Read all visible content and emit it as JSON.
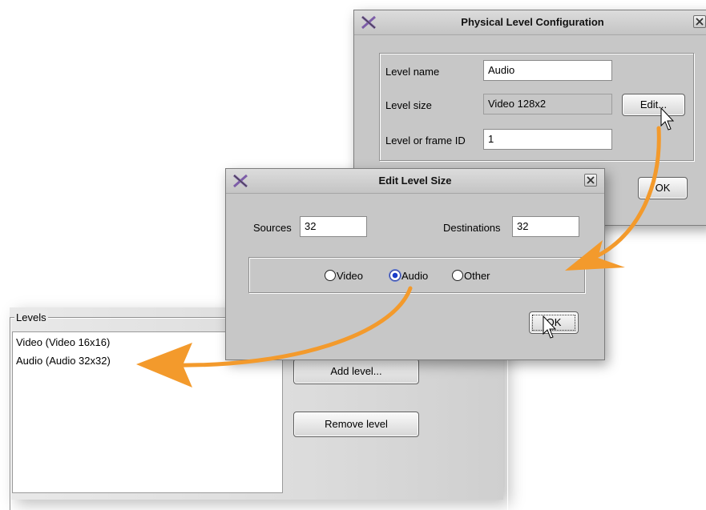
{
  "physical_dialog": {
    "title": "Physical Level Configuration",
    "level_name_label": "Level name",
    "level_name_value": "Audio",
    "level_size_label": "Level size",
    "level_size_value": "Video 128x2",
    "edit_button": "Edit...",
    "frame_id_label": "Level or frame ID",
    "frame_id_value": "1",
    "ok_button": "OK"
  },
  "edit_dialog": {
    "title": "Edit Level Size",
    "sources_label": "Sources",
    "sources_value": "32",
    "destinations_label": "Destinations",
    "destinations_value": "32",
    "radios": [
      {
        "label": "Video",
        "checked": false
      },
      {
        "label": "Audio",
        "checked": true
      },
      {
        "label": "Other",
        "checked": false
      }
    ],
    "ok_button": "OK"
  },
  "levels_panel": {
    "group_label": "Levels",
    "items": [
      "Video (Video 16x16)",
      "Audio (Audio 32x32)"
    ],
    "add_button": "Add level...",
    "remove_button": "Remove level"
  },
  "colors": {
    "arrow": "#f39a2c",
    "dialog_bg": "#c7c7c7",
    "radio_checked": "#1a3dc9"
  }
}
